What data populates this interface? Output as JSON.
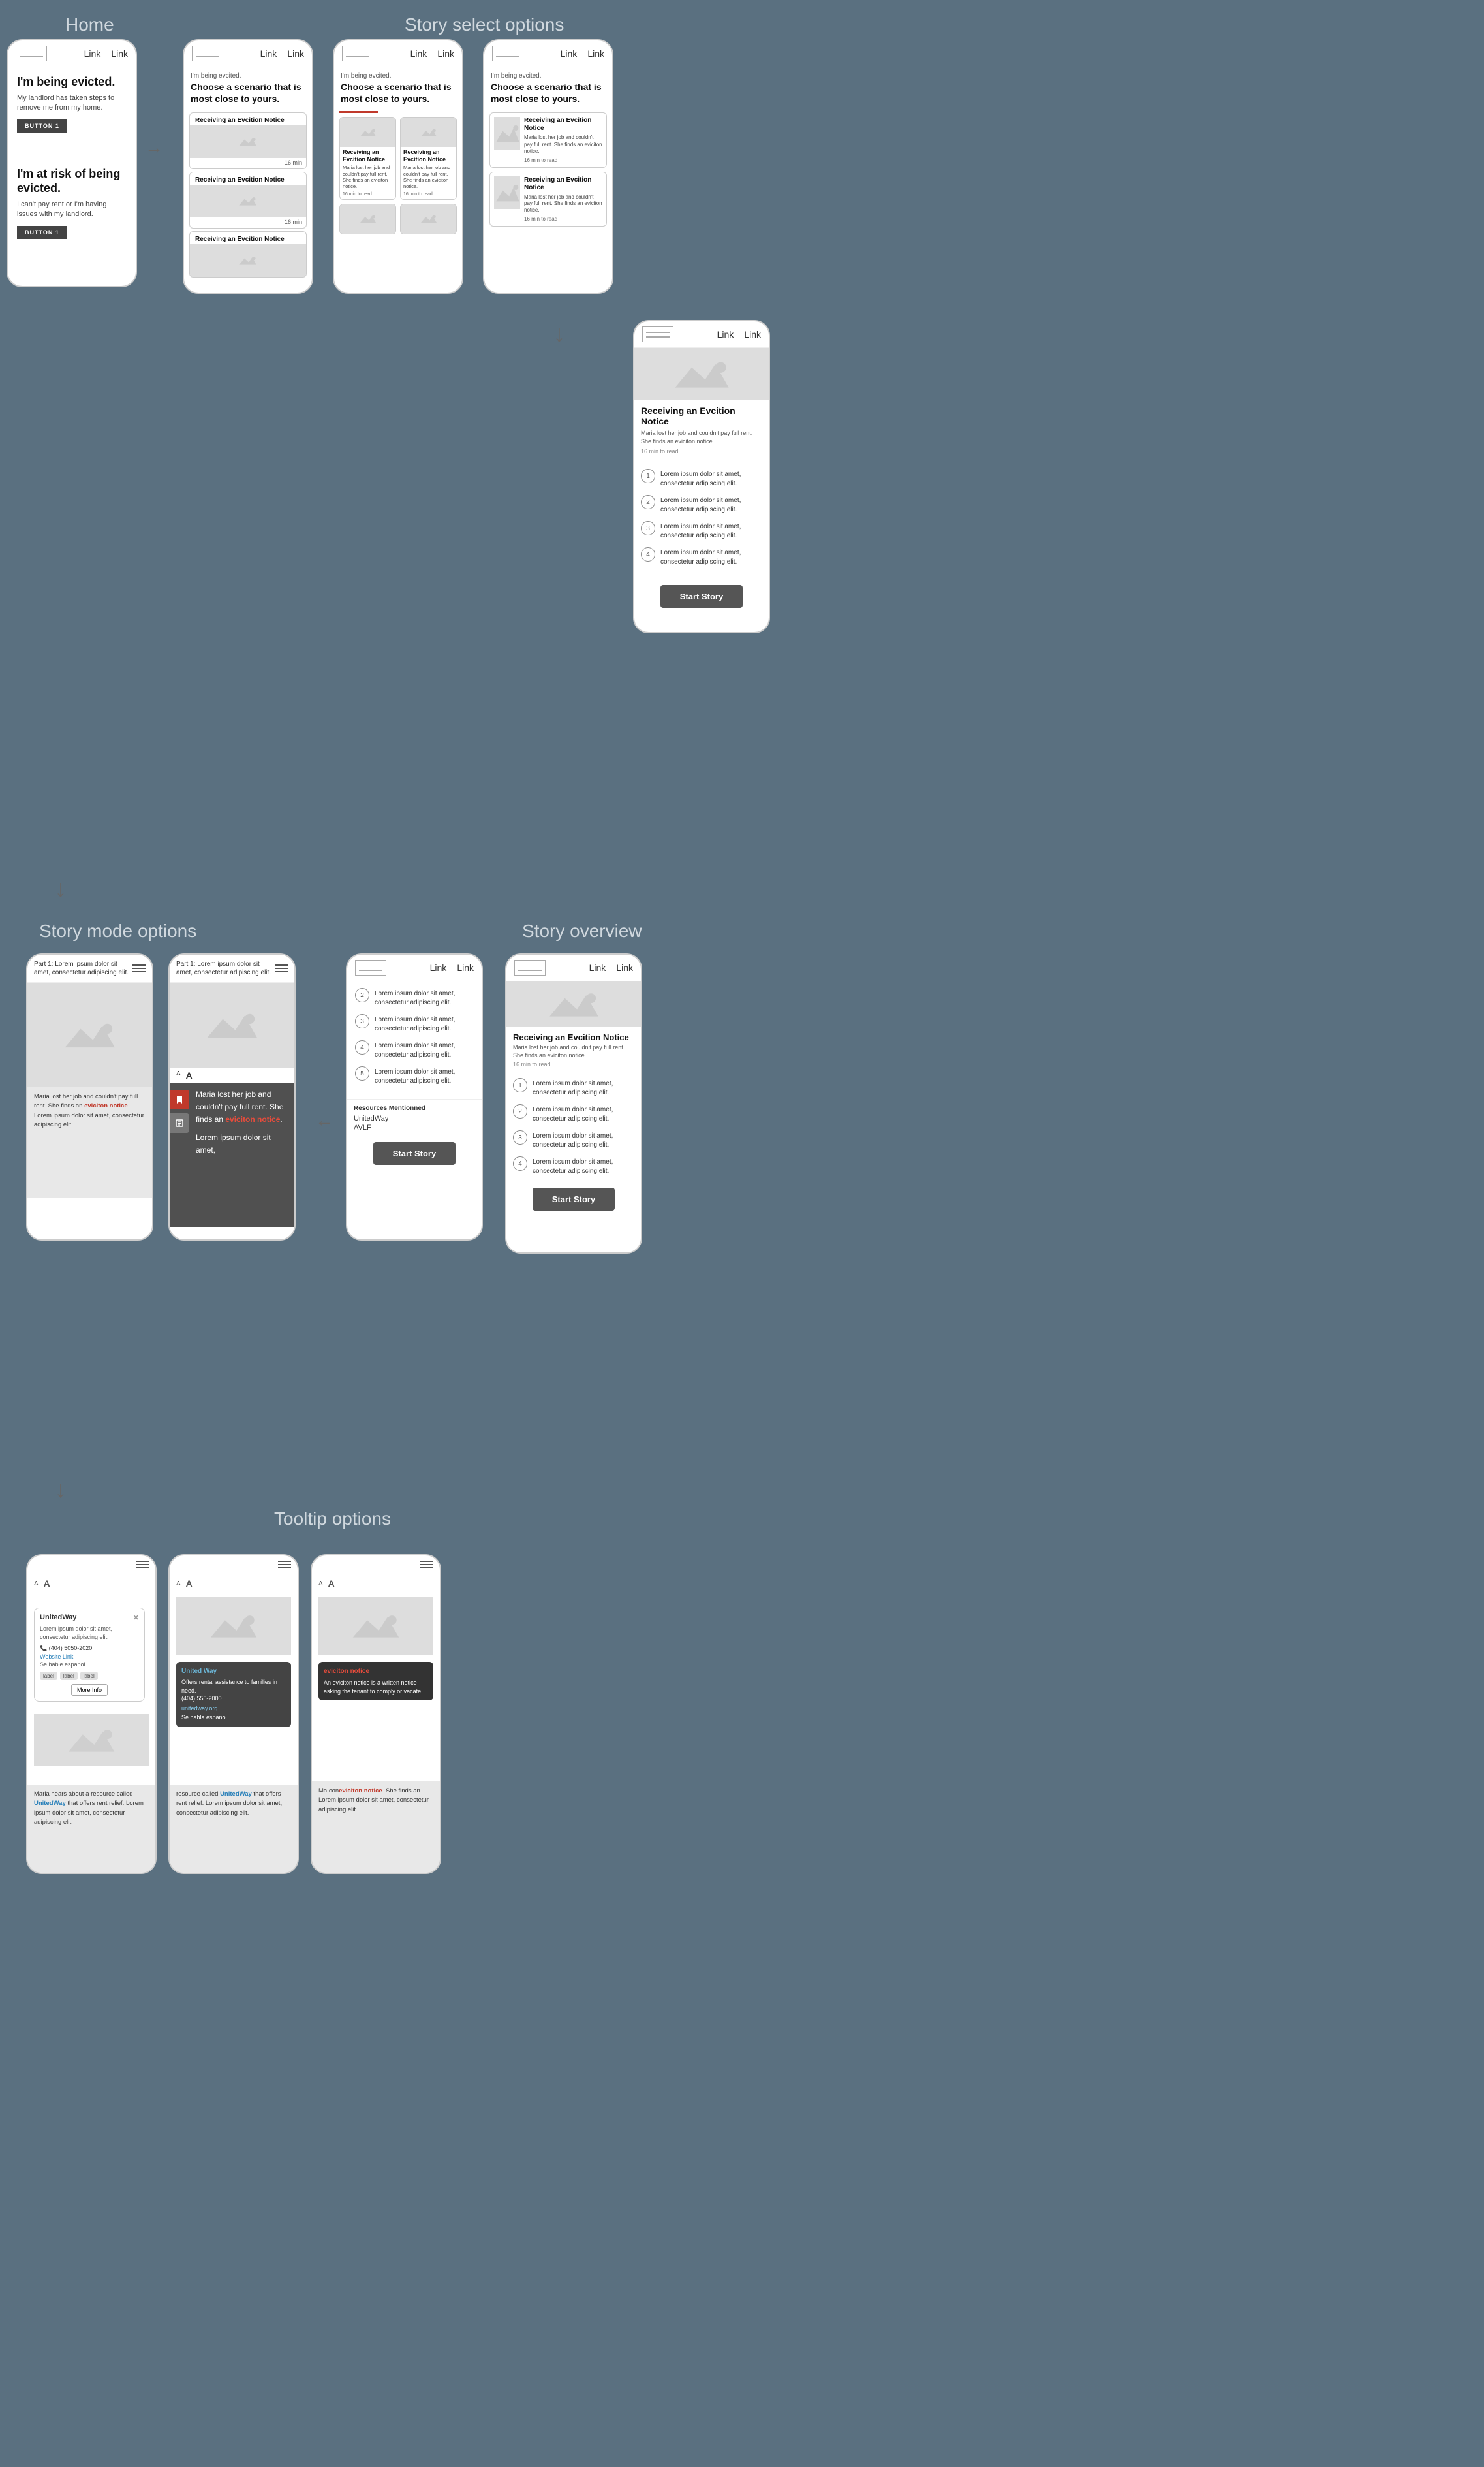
{
  "page": {
    "bg_color": "#5a7080"
  },
  "sections": {
    "home_label": "Home",
    "story_select_label": "Story select options",
    "story_mode_label": "Story mode options",
    "story_overview_label": "Story overview",
    "tooltip_label": "Tooltip options"
  },
  "home_phone": {
    "nav_link1": "Link",
    "nav_link2": "Link",
    "headline1": "I'm being evicted.",
    "subtext1": "My landlord has taken steps to remove me from my home.",
    "btn1": "BUTTON 1",
    "headline2": "I'm at risk of being evicted.",
    "subtext2": "I can't pay rent or I'm having issues with my landlord.",
    "btn2": "BUTTON 1"
  },
  "story_select": {
    "intro_text": "I'm being evcited.",
    "choose_text": "Choose a scenario that is most close to yours.",
    "card1_title": "Receiving an Evcition Notice",
    "card1_time": "16 min",
    "card2_title": "Receiving an Evcition Notice",
    "card2_time": "16 min",
    "card3_title": "Receiving an Evcition Notice"
  },
  "story_grid": {
    "intro_text": "I'm being evcited.",
    "choose_text": "Choose a scenario that is most close to yours.",
    "card1_title": "Receiving an Evcition Notice",
    "card1_desc": "Maria lost her job and couldn't pay full rent. She finds an eviciton notice.",
    "card1_time": "16 min to read",
    "card2_title": "Receiving an Evcition Notice",
    "card2_desc": "Maria lost her job and couldn't pay full rent. She finds an eviciton notice.",
    "card2_time": "16 min to read"
  },
  "story_large": {
    "intro_text": "I'm being evcited.",
    "choose_text": "Choose a scenario that is most close to yours.",
    "card1_title": "Receiving an Evcition Notice",
    "card1_desc": "Maria lost her job and couldn't pay full rent. She finds an eviciton notice.",
    "card1_time": "16 min to read",
    "card2_title": "Receiving an Evcition Notice",
    "card2_desc": "Maria lost her job and couldn't pay full rent. She finds an eviciton notice.",
    "card2_time": "16 min to read"
  },
  "story_mode": {
    "part_header": "Part 1: Lorem ipsum dolor sit amet, consectetur adipiscing elit.",
    "body_text1": "Maria lost her job and couldn't pay full rent. She finds an ",
    "red_word": "eviciton notice",
    "body_text2": ". Lorem ipsum dolor sit amet, consectetur adipiscing elit.",
    "overlay_text1": "Maria lost her job and couldn't pay full rent. She finds an ",
    "overlay_red": "eviciton notice",
    "overlay_text2": ".",
    "overlay_bottom": "Lorem ipsum dolor sit amet,",
    "font_size_small": "A",
    "font_size_large": "A"
  },
  "toc": {
    "item2": "Lorem ipsum dolor sit amet, consectetur adipiscing elit.",
    "item3": "Lorem ipsum dolor sit amet, consectetur adipiscing elit.",
    "item4": "Lorem ipsum dolor sit amet, consectetur adipiscing elit.",
    "item5": "Lorem ipsum dolor sit amet, consectetur adipiscing elit.",
    "resources_label": "Resources Mentionned",
    "resource1": "UnitedWay",
    "resource2": "AVLF",
    "start_story": "Start Story"
  },
  "story_overview": {
    "nav_link1": "Link",
    "nav_link2": "Link",
    "story_title": "Receiving an Evcition Notice",
    "story_desc": "Maria lost her job and couldn't pay full rent. She finds an eviciton notice.",
    "story_time": "16 min to read",
    "item1": "Lorem ipsum dolor sit amet, consectetur adipiscing elit.",
    "item2": "Lorem ipsum dolor sit amet, consectetur adipiscing elit.",
    "item3": "Lorem ipsum dolor sit amet, consectetur adipiscing elit.",
    "item4": "Lorem ipsum dolor sit amet, consectetur adipiscing elit.",
    "start_story": "Start Story"
  },
  "tooltip_options": {
    "label": "Tooltip options",
    "phone1_title": "UnitedWay",
    "phone1_desc": "Lorem ipsum dolor sit amet, consectetur adipiscing elit.",
    "phone1_phone": "(404) 5050-2020",
    "phone1_website": "Website Link",
    "phone1_lang": "Se hable espanol.",
    "phone1_tag1": "label",
    "phone1_tag2": "label",
    "phone1_tag3": "label",
    "phone1_more": "More Info",
    "phone2_title": "United Way",
    "phone2_desc": "Offers rental assistance to families in need.",
    "phone2_phone": "(404) 555-2000",
    "phone2_website": "unitedway.org",
    "phone2_lang": "Se habla espanol.",
    "phone3_word": "eviciton notice",
    "phone3_def": "An eviciton notice is a written notice asking the tenant to comply or vacate.",
    "bottom_text1": "Maria hears about a resource called ",
    "bottom_blue": "UnitedWay",
    "bottom_text2": " that offers rent relief. Lorem ipsum dolor sit amet, consectetur adipiscing elit.",
    "bottom_text_red": "eviciton notice",
    "bottom_text3": ". She finds an ",
    "bottom_text4": " Lorem ipsum dolor sit amet, consectetur adipiscing elit."
  }
}
